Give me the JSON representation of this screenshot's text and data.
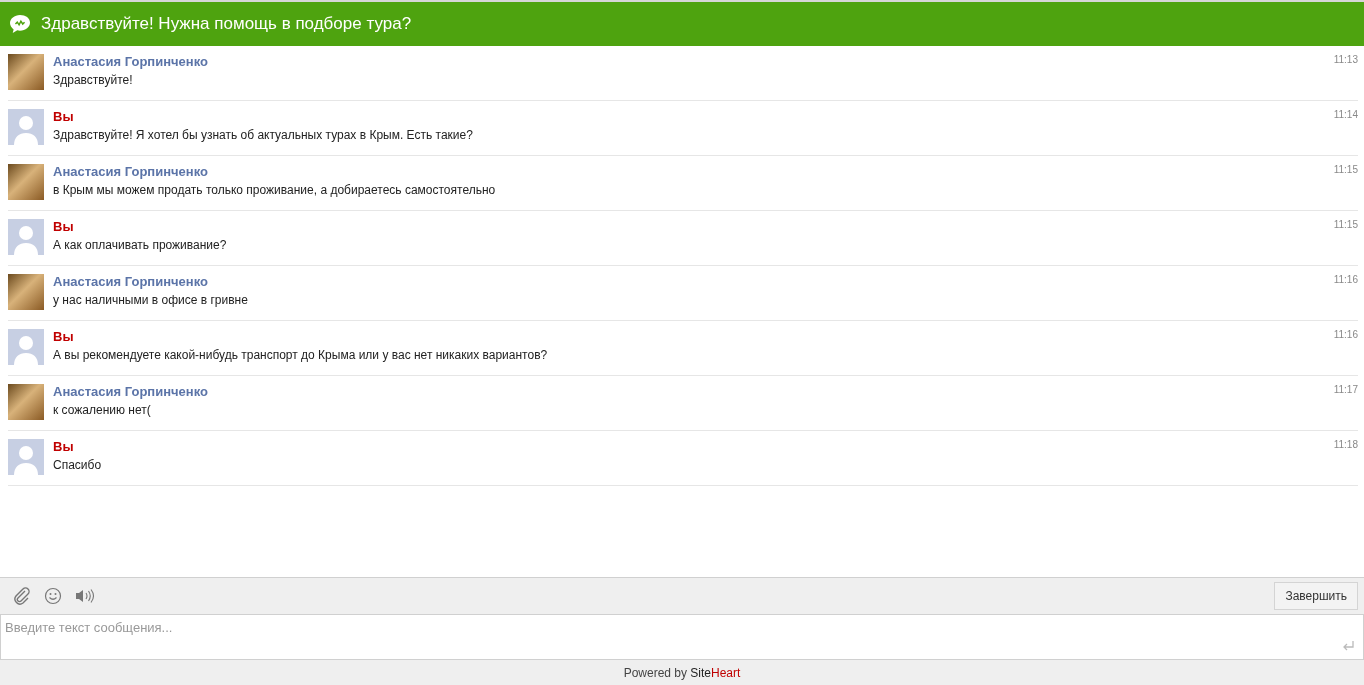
{
  "header": {
    "title": "Здравствуйте! Нужна помощь в подборе тура?"
  },
  "messages": [
    {
      "kind": "operator",
      "author": "Анастасия Горпинченко",
      "text": "Здравствуйте!",
      "time": "11:13"
    },
    {
      "kind": "visitor",
      "author": "Вы",
      "text": "Здравствуйте! Я хотел бы узнать об актуальных турах в Крым. Есть такие?",
      "time": "11:14"
    },
    {
      "kind": "operator",
      "author": "Анастасия Горпинченко",
      "text": "в Крым мы можем продать только проживание, а добираетесь самостоятельно",
      "time": "11:15"
    },
    {
      "kind": "visitor",
      "author": "Вы",
      "text": "А как оплачивать проживание?",
      "time": "11:15"
    },
    {
      "kind": "operator",
      "author": "Анастасия Горпинченко",
      "text": "у нас наличными в офисе в гривне",
      "time": "11:16"
    },
    {
      "kind": "visitor",
      "author": "Вы",
      "text": "А вы рекомендуете какой-нибудь транспорт до Крыма или у вас нет никаких вариантов?",
      "time": "11:16"
    },
    {
      "kind": "operator",
      "author": "Анастасия Горпинченко",
      "text": "к сожалению нет(",
      "time": "11:17"
    },
    {
      "kind": "visitor",
      "author": "Вы",
      "text": "Спасибо",
      "time": "11:18"
    }
  ],
  "toolbar": {
    "end_button": "Завершить"
  },
  "composer": {
    "placeholder": "Введите текст сообщения..."
  },
  "footer": {
    "prefix": "Powered by",
    "brand_first": "Site",
    "brand_second": "Heart"
  }
}
